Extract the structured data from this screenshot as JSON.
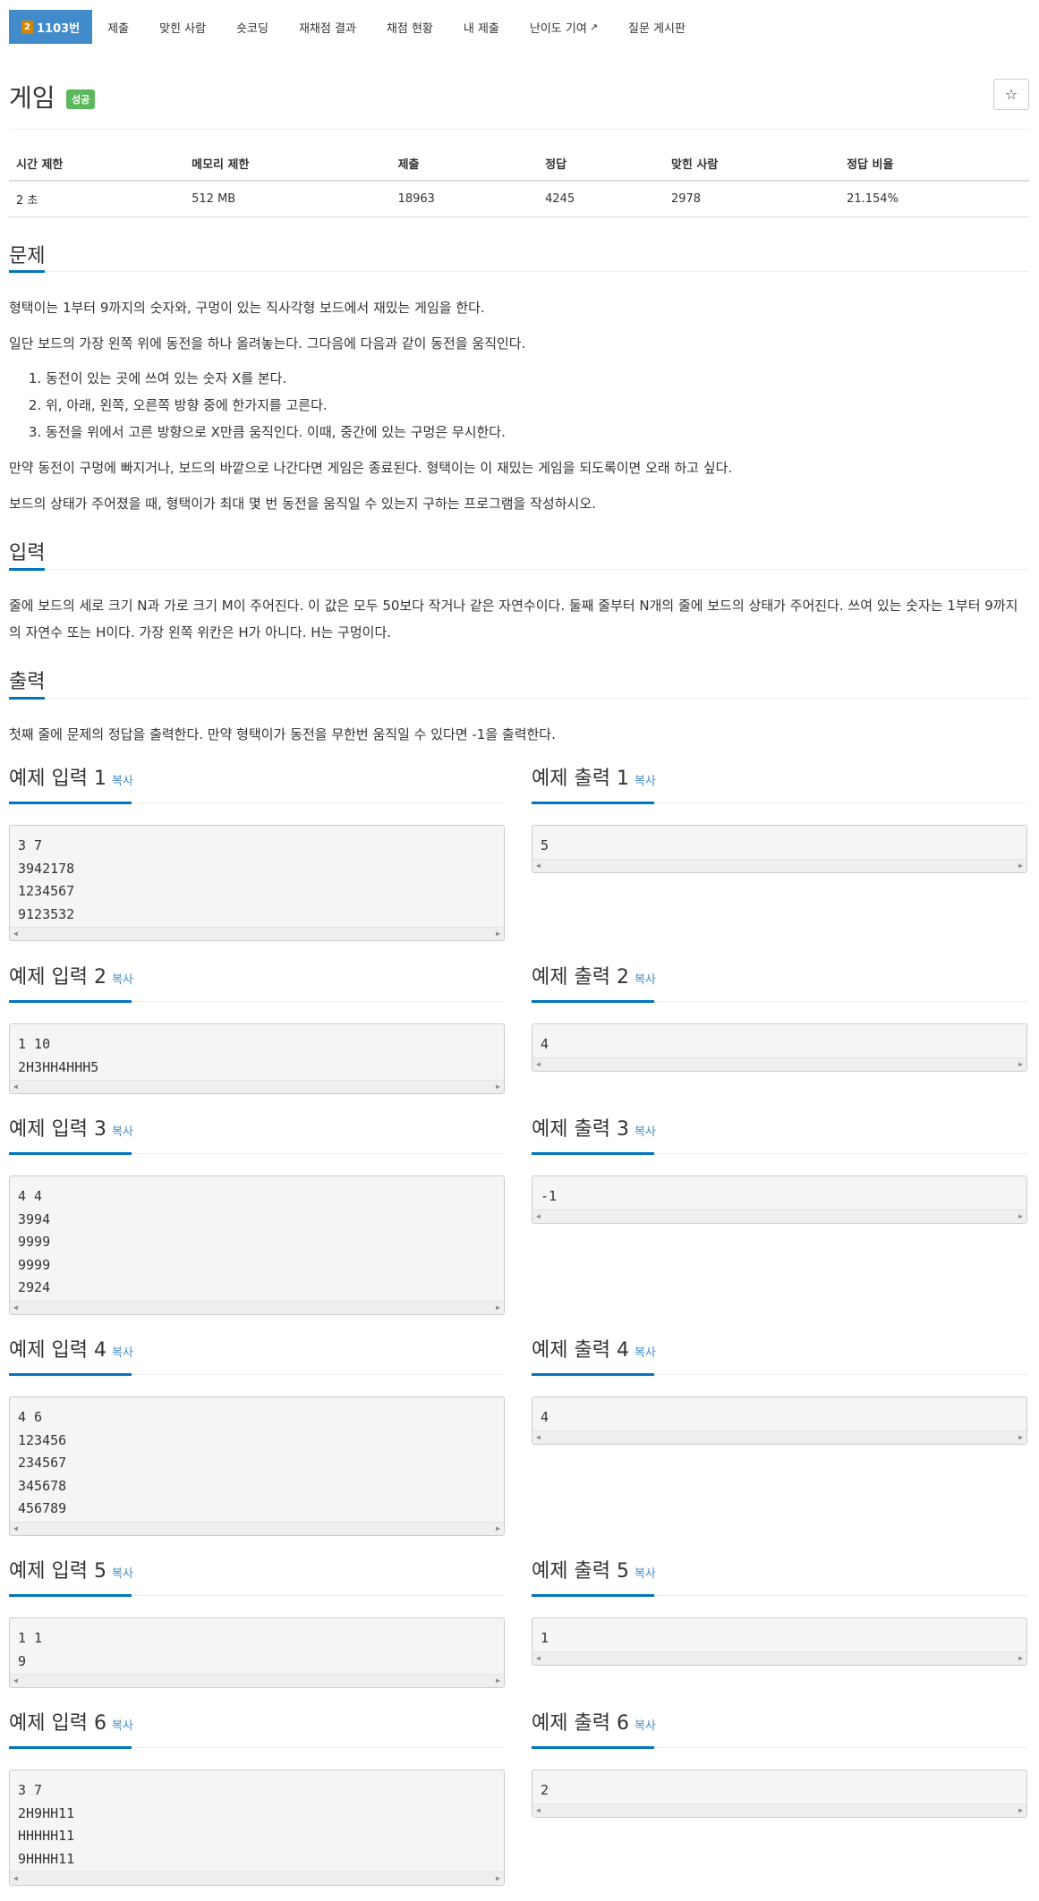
{
  "nav": {
    "tier": "2",
    "problem_id": "1103번",
    "items": [
      "제출",
      "맞힌 사람",
      "숏코딩",
      "재채점 결과",
      "채점 현황",
      "내 제출",
      "난이도 기여",
      "질문 게시판"
    ],
    "external_link_icon": "external-link-icon"
  },
  "title": {
    "text": "게임",
    "badge": "성공",
    "star_icon": "☆"
  },
  "info_table": {
    "headers": [
      "시간 제한",
      "메모리 제한",
      "제출",
      "정답",
      "맞힌 사람",
      "정답 비율"
    ],
    "values": [
      "2 초",
      "512 MB",
      "18963",
      "4245",
      "2978",
      "21.154%"
    ]
  },
  "sections": {
    "problem": {
      "title": "문제",
      "p1": "형택이는 1부터 9까지의 숫자와, 구멍이 있는 직사각형 보드에서 재밌는 게임을 한다.",
      "p2": "일단 보드의 가장 왼쪽 위에 동전을 하나 올려놓는다. 그다음에 다음과 같이 동전을 움직인다.",
      "steps": [
        "동전이 있는 곳에 쓰여 있는 숫자 X를 본다.",
        "위, 아래, 왼쪽, 오른쪽 방향 중에 한가지를 고른다.",
        "동전을 위에서 고른 방향으로 X만큼 움직인다. 이때, 중간에 있는 구멍은 무시한다."
      ],
      "p3": "만약 동전이 구멍에 빠지거나, 보드의 바깥으로 나간다면 게임은 종료된다. 형택이는 이 재밌는 게임을 되도록이면 오래 하고 싶다.",
      "p4": "보드의 상태가 주어졌을 때, 형택이가 최대 몇 번 동전을 움직일 수 있는지 구하는 프로그램을 작성하시오."
    },
    "input": {
      "title": "입력",
      "p1": "줄에 보드의 세로 크기 N과 가로 크기 M이 주어진다. 이 값은 모두 50보다 작거나 같은 자연수이다. 둘째 줄부터 N개의 줄에 보드의 상태가 주어진다. 쓰여 있는 숫자는 1부터 9까지의 자연수 또는 H이다. 가장 왼쪽 위칸은 H가 아니다. H는 구멍이다."
    },
    "output": {
      "title": "출력",
      "p1": "첫째 줄에 문제의 정답을 출력한다. 만약 형택이가 동전을 무한번 움직일 수 있다면 -1을 출력한다."
    }
  },
  "copy_label": "복사",
  "examples": [
    {
      "in_title": "예제 입력 1",
      "out_title": "예제 출력 1",
      "input": [
        "3 7",
        "3942178",
        "1234567",
        "9123532"
      ],
      "output": [
        "5"
      ]
    },
    {
      "in_title": "예제 입력 2",
      "out_title": "예제 출력 2",
      "input": [
        "1 10",
        "2H3HH4HHH5"
      ],
      "output": [
        "4"
      ]
    },
    {
      "in_title": "예제 입력 3",
      "out_title": "예제 출력 3",
      "input": [
        "4 4",
        "3994",
        "9999",
        "9999",
        "2924"
      ],
      "output": [
        "-1"
      ]
    },
    {
      "in_title": "예제 입력 4",
      "out_title": "예제 출력 4",
      "input": [
        "4 6",
        "123456",
        "234567",
        "345678",
        "456789"
      ],
      "output": [
        "4"
      ]
    },
    {
      "in_title": "예제 입력 5",
      "out_title": "예제 출력 5",
      "input": [
        "1 1",
        "9"
      ],
      "output": [
        "1"
      ]
    },
    {
      "in_title": "예제 입력 6",
      "out_title": "예제 출력 6",
      "input": [
        "3 7",
        "2H9HH11",
        "HHHHH11",
        "9HHHH11"
      ],
      "output": [
        "2"
      ]
    }
  ]
}
